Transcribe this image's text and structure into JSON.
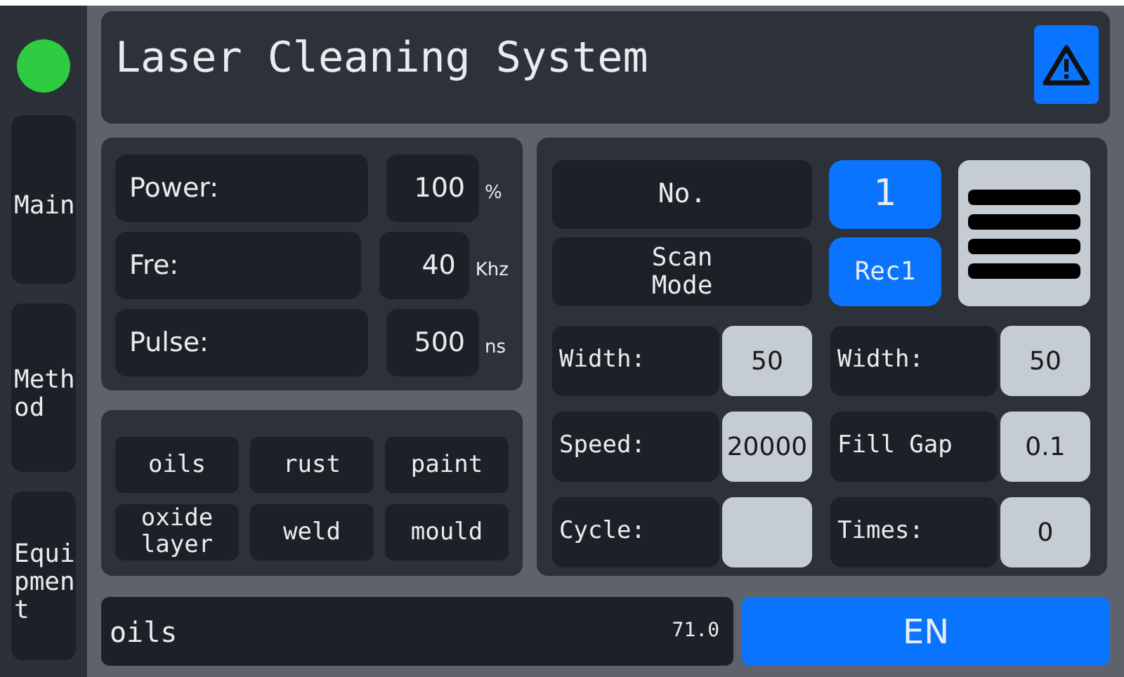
{
  "status": {
    "color": "#2ecc40"
  },
  "sidebar": {
    "items": [
      {
        "label": "Main",
        "selected": false
      },
      {
        "label": "Meth\nod",
        "selected": false
      },
      {
        "label": "Equi\npmen\nt",
        "selected": false
      }
    ]
  },
  "header": {
    "title": "Laser Cleaning System"
  },
  "parameters": [
    {
      "label": "Power:",
      "value": "100",
      "unit": "%"
    },
    {
      "label": "Fre:",
      "value": "40",
      "unit": "Khz"
    },
    {
      "label": "Pulse:",
      "value": "500",
      "unit": "ns"
    }
  ],
  "materials": [
    {
      "label": "oils"
    },
    {
      "label": "rust"
    },
    {
      "label": "paint"
    },
    {
      "label": "oxide\nlayer"
    },
    {
      "label": "weld"
    },
    {
      "label": "mould"
    }
  ],
  "scan": {
    "number_label": "No.",
    "number": "1",
    "mode_label": "Scan\nMode",
    "mode": "Rec1"
  },
  "settings": [
    {
      "label": "Width:",
      "value": "50"
    },
    {
      "label": "Width:",
      "value": "50"
    },
    {
      "label": "Speed:",
      "value": "20000"
    },
    {
      "label": "Fill Gap",
      "value": "0.1"
    },
    {
      "label": "Cycle:"
    },
    {
      "label": "Times:",
      "value": "0"
    }
  ],
  "footer": {
    "material": "oils",
    "reading": "71.0",
    "language": "EN"
  }
}
